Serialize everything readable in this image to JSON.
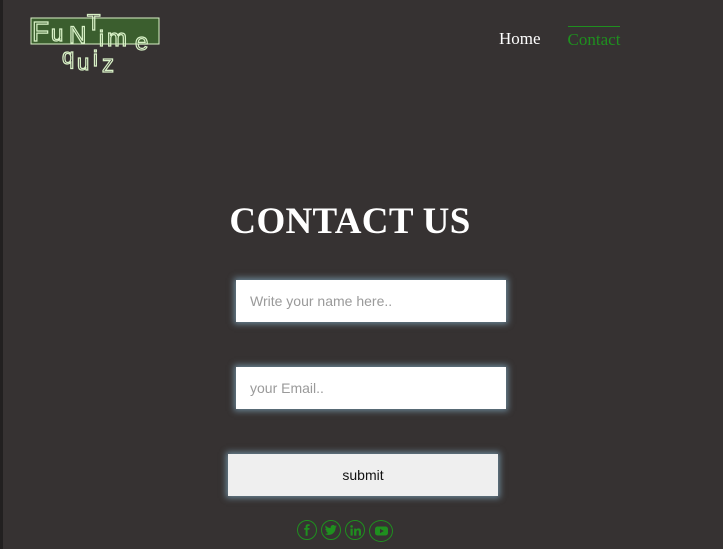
{
  "logo": {
    "letters": {
      "f": "F",
      "u": "u",
      "n": "N",
      "t": "T",
      "i": "i",
      "m": "m",
      "e": "e",
      "q": "q",
      "u2": "u",
      "i2": "i",
      "z": "z"
    },
    "colors": {
      "fill": "#3b5e2e",
      "stroke": "#d9f2c7"
    }
  },
  "nav": {
    "items": [
      {
        "label": "Home",
        "active": false
      },
      {
        "label": "Contact",
        "active": true
      }
    ]
  },
  "heading": {
    "title": "CONTACT US"
  },
  "form": {
    "name_placeholder": "Write your name here..",
    "email_placeholder": "your Email..",
    "submit_label": "submit"
  },
  "socials": [
    {
      "icon": "facebook-icon"
    },
    {
      "icon": "twitter-icon"
    },
    {
      "icon": "linkedin-icon"
    },
    {
      "icon": "youtube-icon"
    }
  ],
  "colors": {
    "background": "#363232",
    "accent": "#1f8f1f",
    "text": "#ffffff"
  }
}
